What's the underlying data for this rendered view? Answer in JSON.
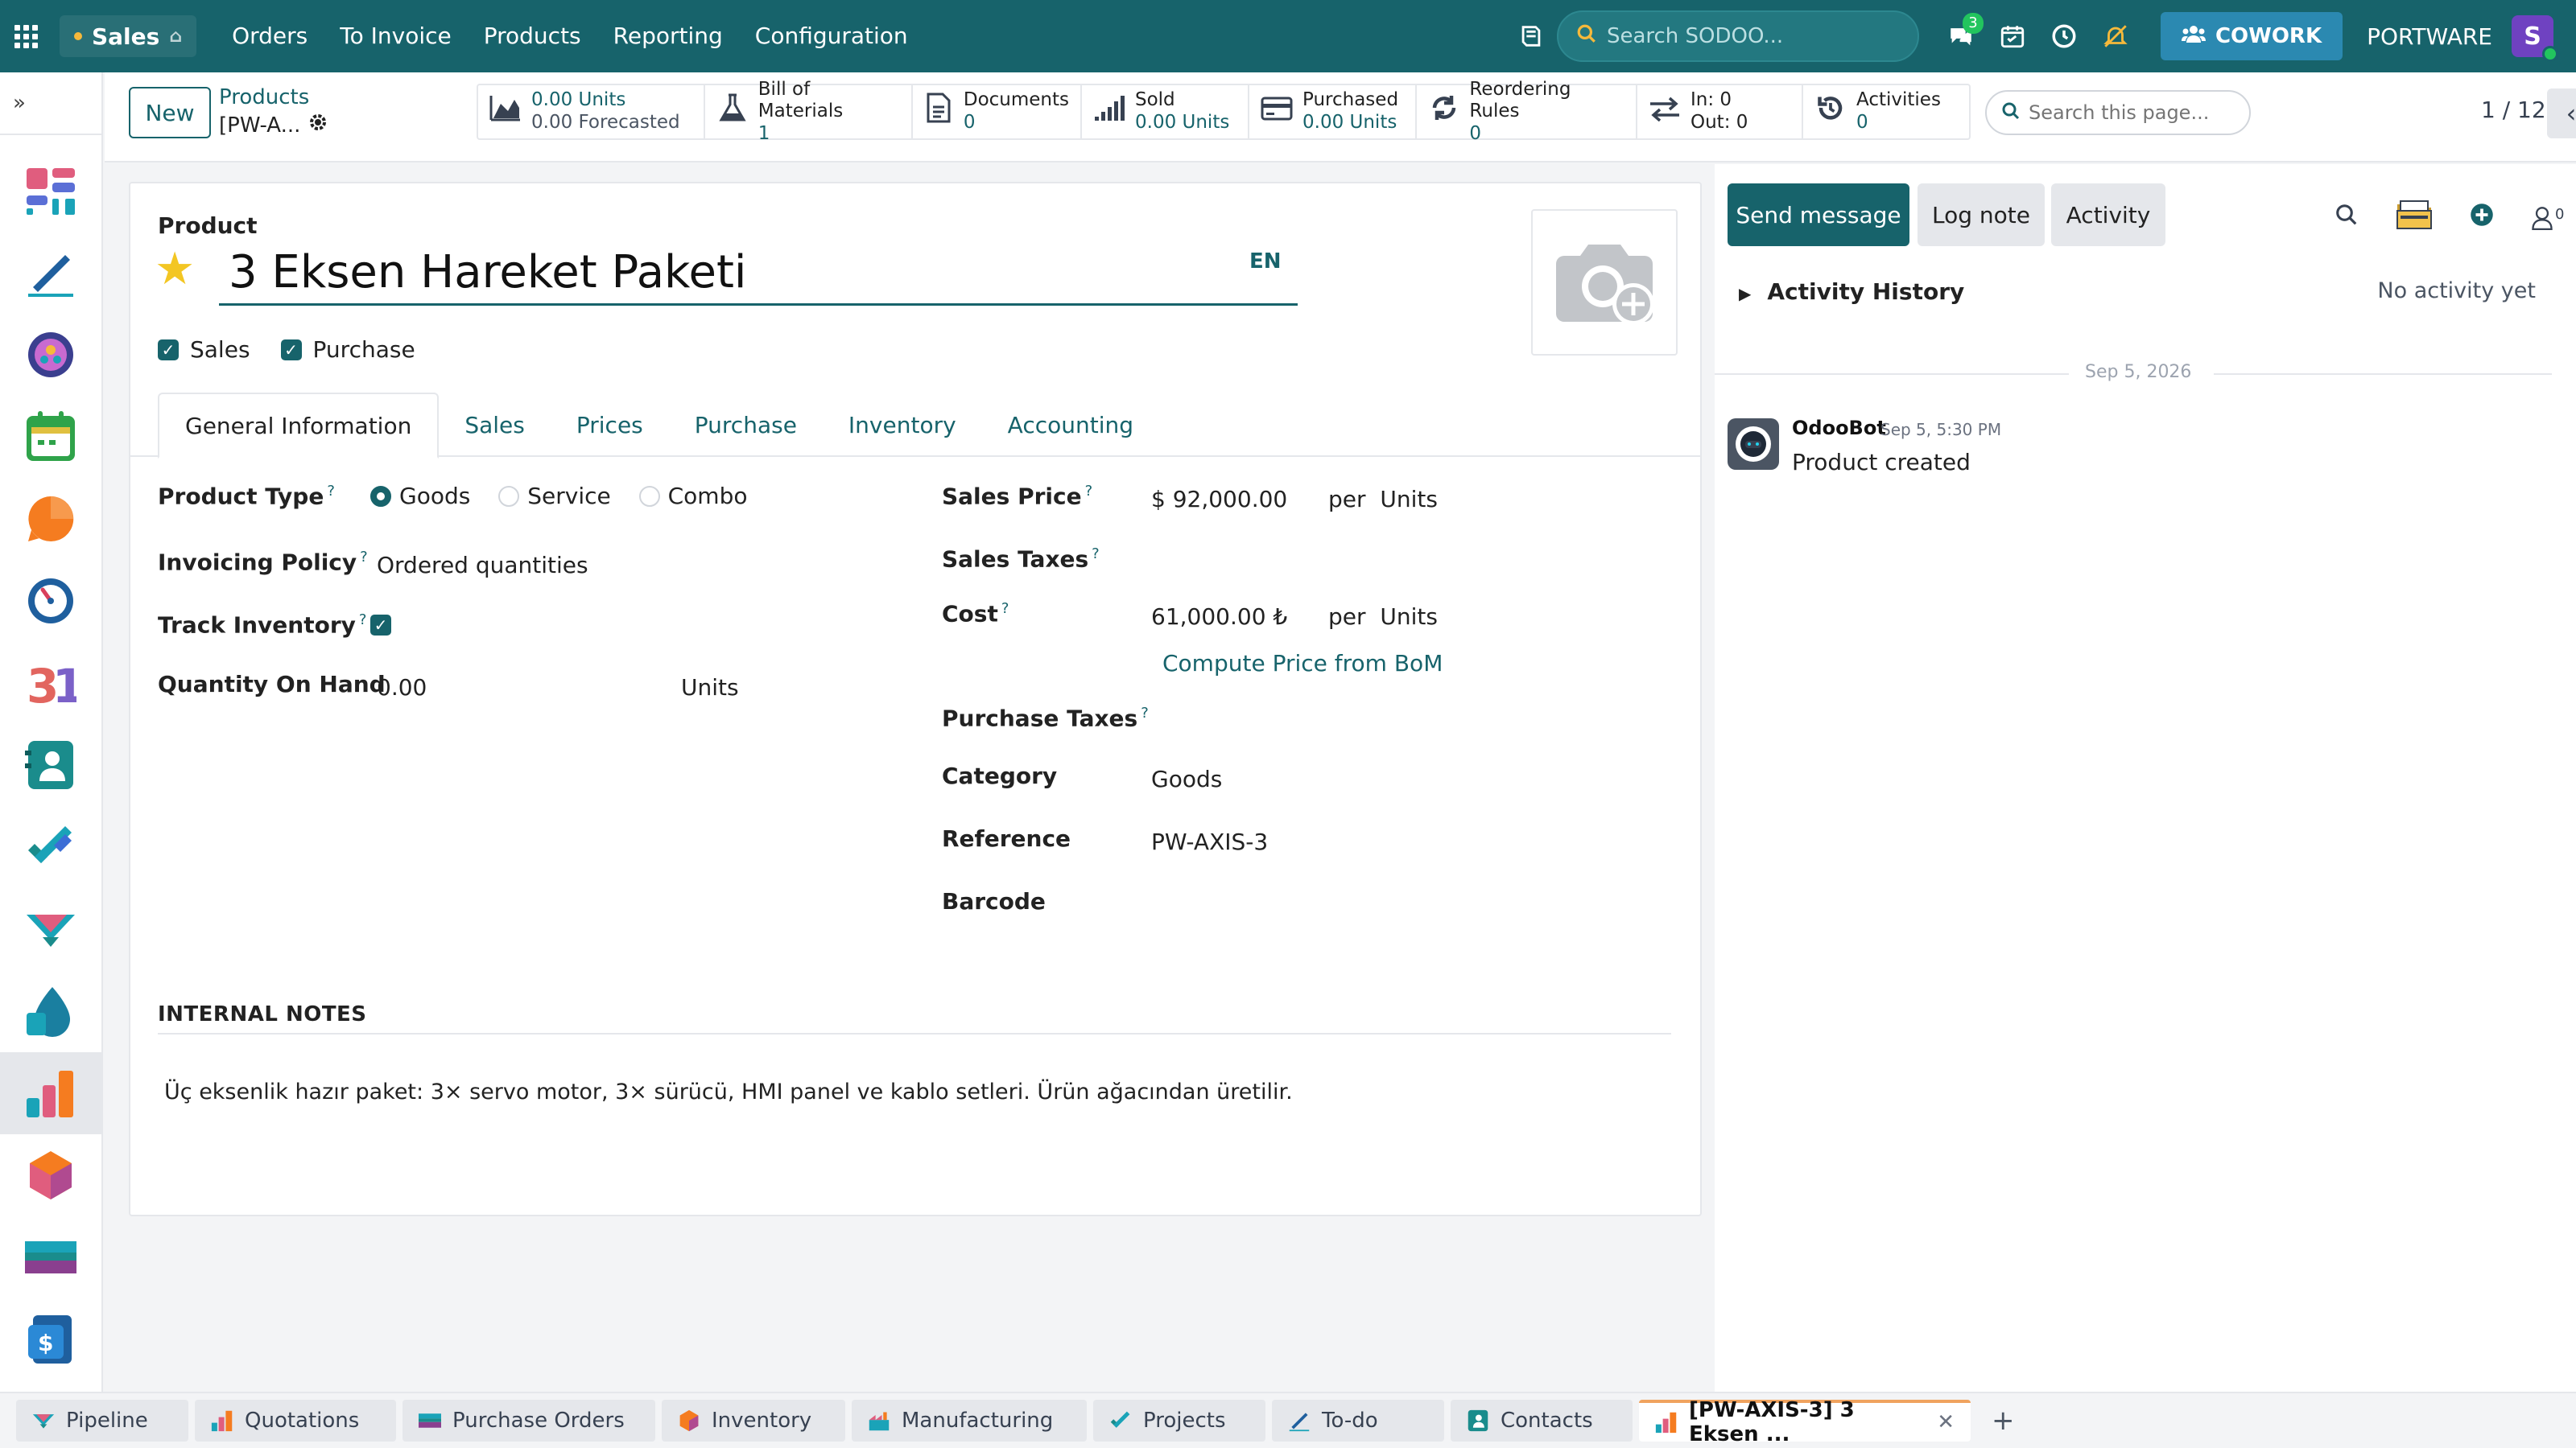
{
  "topnav": {
    "app_name": "Sales",
    "menu": [
      "Orders",
      "To Invoice",
      "Products",
      "Reporting",
      "Configuration"
    ],
    "search_placeholder": "Search SODOO...",
    "chat_badge": "3",
    "cowork_label": "COWORK",
    "company": "PORTWARE",
    "avatar_initial": "S"
  },
  "control": {
    "new_label": "New",
    "breadcrumb_parent": "Products",
    "breadcrumb_record": "[PW-A...",
    "smart_buttons": [
      {
        "line1": "0.00 Units",
        "line2": "0.00 Forecasted"
      },
      {
        "line1": "Bill of Materials",
        "line2": "1"
      },
      {
        "line1": "Documents",
        "line2": "0"
      },
      {
        "line1": "Sold",
        "line2": "0.00 Units"
      },
      {
        "line1": "Purchased",
        "line2": "0.00 Units"
      },
      {
        "line1": "Reordering Rules",
        "line2": "0"
      },
      {
        "line1": "In: 0",
        "line2": "Out: 0"
      },
      {
        "line1": "Activities",
        "line2": "0"
      }
    ],
    "page_search_placeholder": "Search this page...",
    "pager": "1 / 12"
  },
  "form": {
    "product_label": "Product",
    "product_name": "3 Eksen Hareket Paketi",
    "lang": "EN",
    "sales_flag": "Sales",
    "purchase_flag": "Purchase",
    "tabs": [
      "General Information",
      "Sales",
      "Prices",
      "Purchase",
      "Inventory",
      "Accounting"
    ],
    "left": {
      "product_type_label": "Product Type",
      "type_options": [
        "Goods",
        "Service",
        "Combo"
      ],
      "invoicing_policy_label": "Invoicing Policy",
      "invoicing_policy": "Ordered quantities",
      "track_inventory_label": "Track Inventory",
      "qty_on_hand_label": "Quantity On Hand",
      "qty_on_hand": "0.00",
      "qty_uom": "Units"
    },
    "right": {
      "sales_price_label": "Sales Price",
      "sales_price": "$ 92,000.00",
      "per_label": "per",
      "uom": "Units",
      "sales_taxes_label": "Sales Taxes",
      "cost_label": "Cost",
      "cost": "61,000.00 ₺",
      "compute_link": "Compute Price from BoM",
      "purchase_taxes_label": "Purchase Taxes",
      "category_label": "Category",
      "category": "Goods",
      "reference_label": "Reference",
      "reference": "PW-AXIS-3",
      "barcode_label": "Barcode"
    },
    "notes_header": "INTERNAL NOTES",
    "notes": "Üç eksenlik hazır paket: 3× servo motor, 3× sürücü, HMI panel ve kablo setleri. Ürün ağacından üretilir."
  },
  "chatter": {
    "send_message": "Send message",
    "log_note": "Log note",
    "activity": "Activity",
    "followers_count": "0",
    "activity_history": "Activity History",
    "no_activity": "No activity yet",
    "date": "Sep 5, 2026",
    "author": "OdooBot",
    "time": "Sep 5, 5:30 PM",
    "message": "Product created"
  },
  "taskbar": [
    "Pipeline",
    "Quotations",
    "Purchase Orders",
    "Inventory",
    "Manufacturing",
    "Projects",
    "To-do",
    "Contacts",
    "[PW-AXIS-3] 3 Eksen ..."
  ]
}
